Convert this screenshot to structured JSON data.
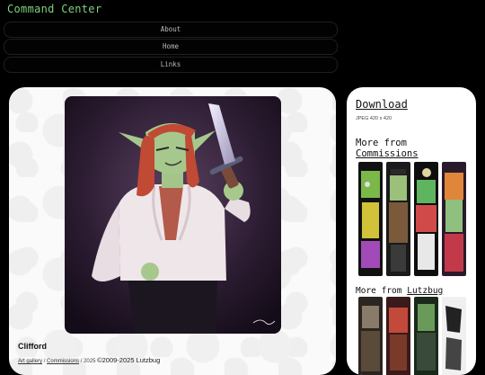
{
  "header": {
    "title": "Command Center"
  },
  "nav": {
    "items": [
      {
        "label": "About"
      },
      {
        "label": "Home"
      },
      {
        "label": "Links"
      }
    ]
  },
  "artwork": {
    "title": "Clifford",
    "breadcrumb": {
      "gallery": "Art gallery",
      "sep1": "/",
      "category": "Commissions",
      "sep2": "/",
      "year": "2025"
    },
    "copyright": "©2009-2025 Lutzbug"
  },
  "sidebar": {
    "download_label": "Download",
    "download_meta": "JPEG 420 x 420",
    "more_from_1": "More from",
    "more_from_1_link": "Commissions",
    "more_from_2": "More from",
    "more_from_2_link": "Lutzbug"
  },
  "colors": {
    "header_text": "#7fd17f",
    "background": "#000000",
    "panel": "#fafafa"
  }
}
